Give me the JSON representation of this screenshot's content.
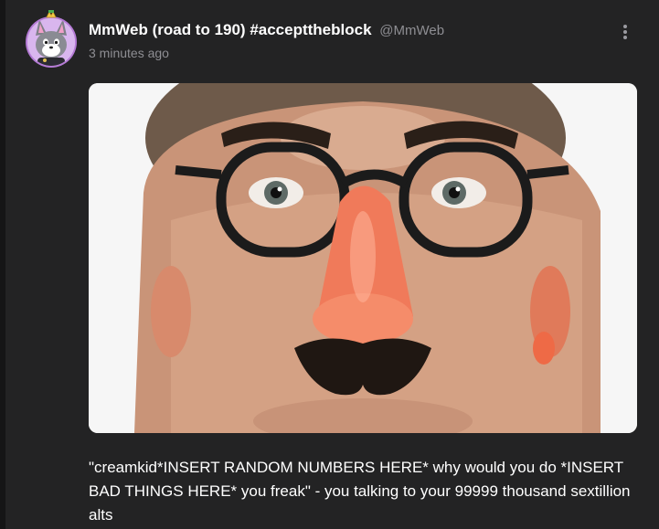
{
  "post": {
    "author": {
      "display_name": "MmWeb (road to 190) #accepttheblock",
      "handle": "@MmWeb"
    },
    "timestamp": "3 minutes ago",
    "menu_icon": "more-vertical-icon",
    "media": {
      "subject": "photo"
    },
    "text": "\"creamkid*INSERT RANDOM NUMBERS HERE* why would you do *INSERT BAD THINGS HERE* you freak\" - you talking to your 99999 thousand sextillion alts"
  },
  "colors": {
    "background": "#232324",
    "text": "#ffffff",
    "muted": "#8e8e93"
  }
}
